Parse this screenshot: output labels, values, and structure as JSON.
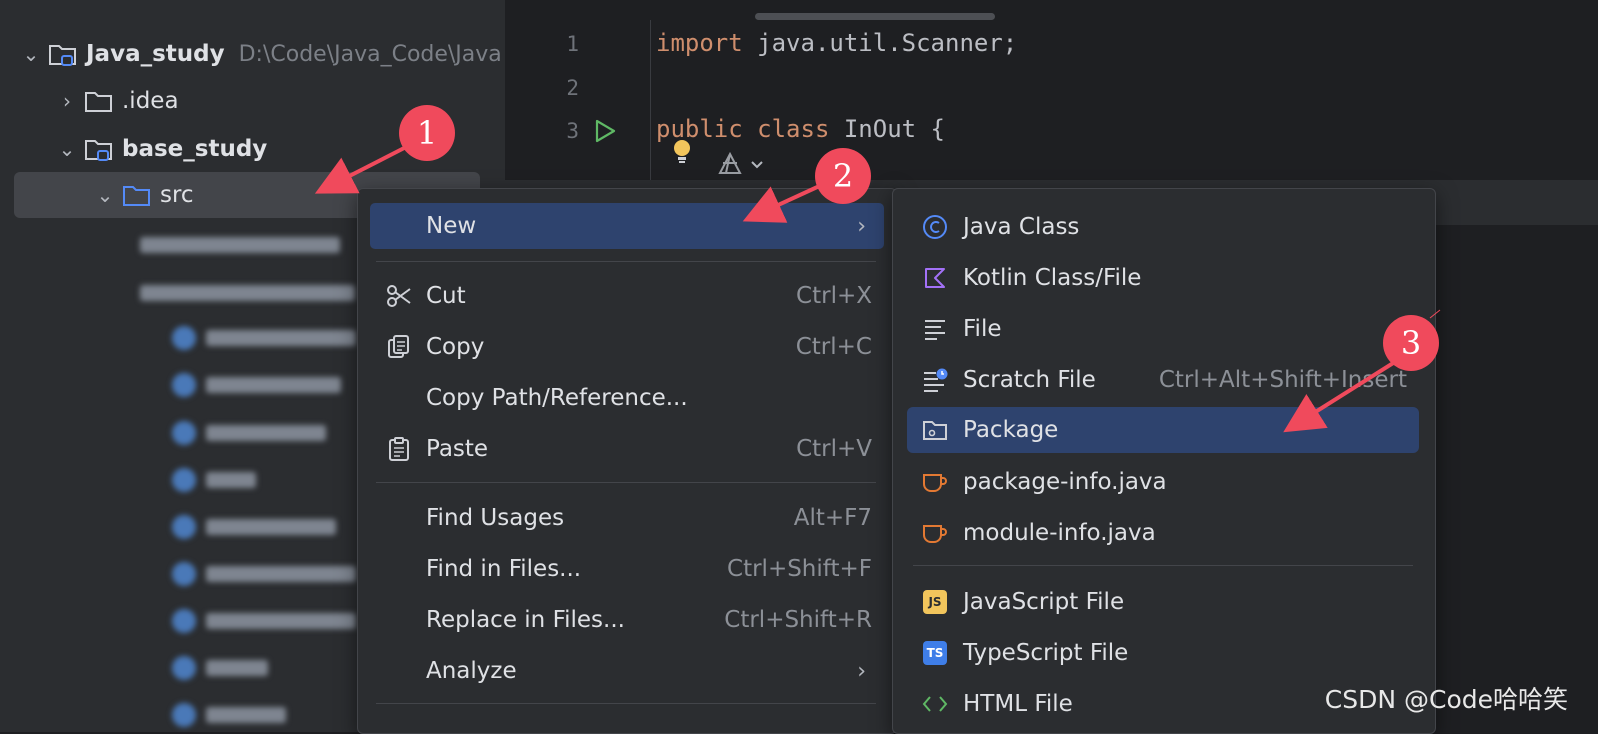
{
  "tree": {
    "project_name": "Java_study",
    "project_path": "D:\\Code\\Java_Code\\Java",
    "items": [
      {
        "label": ".idea"
      },
      {
        "label": "base_study"
      },
      {
        "label": "src"
      }
    ]
  },
  "editor": {
    "lines": [
      {
        "num": "1",
        "keyword": "import",
        "rest": " java.util.Scanner;"
      },
      {
        "num": "2",
        "keyword": "",
        "rest": ""
      },
      {
        "num": "3",
        "keyword": "public class",
        "rest": " InOut {"
      }
    ]
  },
  "context_menu": {
    "items": [
      {
        "label": "New",
        "shortcut": ""
      },
      {
        "label": "Cut",
        "shortcut": "Ctrl+X"
      },
      {
        "label": "Copy",
        "shortcut": "Ctrl+C"
      },
      {
        "label": "Copy Path/Reference...",
        "shortcut": ""
      },
      {
        "label": "Paste",
        "shortcut": "Ctrl+V"
      },
      {
        "label": "Find Usages",
        "shortcut": "Alt+F7"
      },
      {
        "label": "Find in Files...",
        "shortcut": "Ctrl+Shift+F"
      },
      {
        "label": "Replace in Files...",
        "shortcut": "Ctrl+Shift+R"
      },
      {
        "label": "Analyze",
        "shortcut": ""
      }
    ]
  },
  "submenu": {
    "items": [
      {
        "label": "Java Class",
        "shortcut": ""
      },
      {
        "label": "Kotlin Class/File",
        "shortcut": ""
      },
      {
        "label": "File",
        "shortcut": ""
      },
      {
        "label": "Scratch File",
        "shortcut": "Ctrl+Alt+Shift+Insert"
      },
      {
        "label": "Package",
        "shortcut": ""
      },
      {
        "label": "package-info.java",
        "shortcut": ""
      },
      {
        "label": "module-info.java",
        "shortcut": ""
      },
      {
        "label": "JavaScript File",
        "shortcut": ""
      },
      {
        "label": "TypeScript File",
        "shortcut": ""
      },
      {
        "label": "HTML File",
        "shortcut": ""
      }
    ],
    "badges": {
      "js": "JS",
      "ts": "TS"
    }
  },
  "callouts": [
    "1",
    "2",
    "3"
  ],
  "watermark": "CSDN @Code哈哈笑",
  "colors": {
    "accent": "#2e436e",
    "callout": "#f04a5c",
    "keyword": "#cf8e6d"
  }
}
